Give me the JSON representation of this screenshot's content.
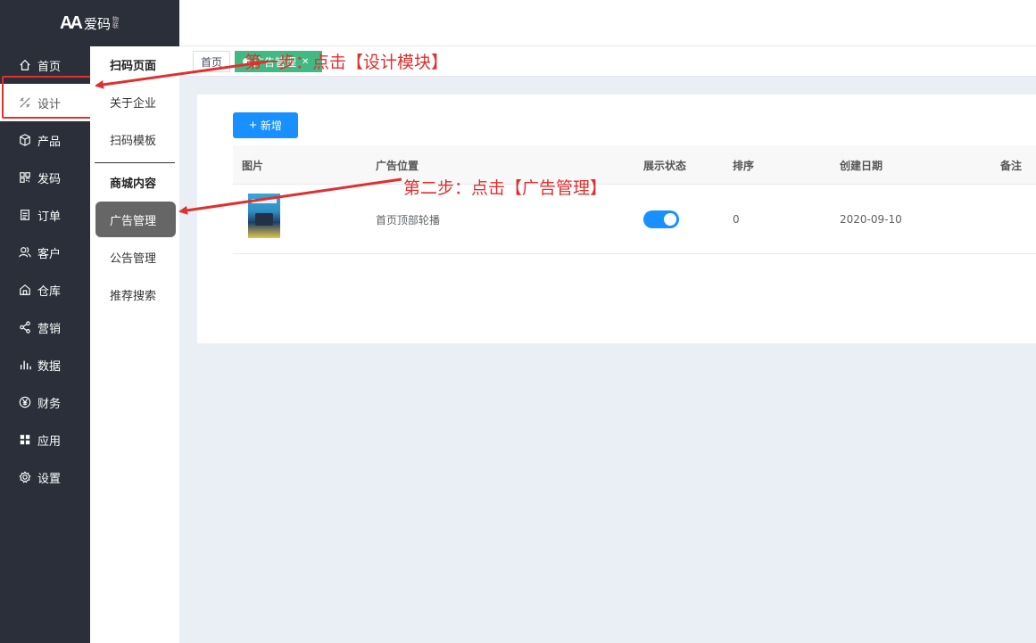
{
  "brand": {
    "name": "爱码",
    "sub": "物联"
  },
  "nav": [
    {
      "label": "首页",
      "icon": "home-icon"
    },
    {
      "label": "设计",
      "icon": "design-icon"
    },
    {
      "label": "产品",
      "icon": "cube-icon"
    },
    {
      "label": "发码",
      "icon": "qrcode-icon"
    },
    {
      "label": "订单",
      "icon": "order-icon"
    },
    {
      "label": "客户",
      "icon": "users-icon"
    },
    {
      "label": "仓库",
      "icon": "warehouse-icon"
    },
    {
      "label": "营销",
      "icon": "share-icon"
    },
    {
      "label": "数据",
      "icon": "bar-chart-icon"
    },
    {
      "label": "财务",
      "icon": "yen-icon"
    },
    {
      "label": "应用",
      "icon": "grid-icon"
    },
    {
      "label": "设置",
      "icon": "gear-icon"
    }
  ],
  "submenu": {
    "group1": "扫码页面",
    "items1": [
      "关于企业",
      "扫码模板"
    ],
    "group2": "商城内容",
    "items2": [
      "广告管理",
      "公告管理",
      "推荐搜索"
    ]
  },
  "tabs": {
    "home": "首页",
    "current": "广告管理"
  },
  "toolbar": {
    "add_label": "新增"
  },
  "table": {
    "columns": [
      "图片",
      "广告位置",
      "展示状态",
      "排序",
      "创建日期",
      "备注"
    ],
    "rows": [
      {
        "position": "首页顶部轮播",
        "status_on": true,
        "sort": "0",
        "created": "2020-09-10",
        "remark": ""
      }
    ]
  },
  "annotations": {
    "step1": "第一步：点击【设计模块】",
    "step2": "第二步：点击【广告管理】"
  },
  "colors": {
    "sidebar": "#2b2f3a",
    "primary": "#1890ff",
    "tab_active": "#42b983",
    "annotation": "#e02f2f"
  }
}
